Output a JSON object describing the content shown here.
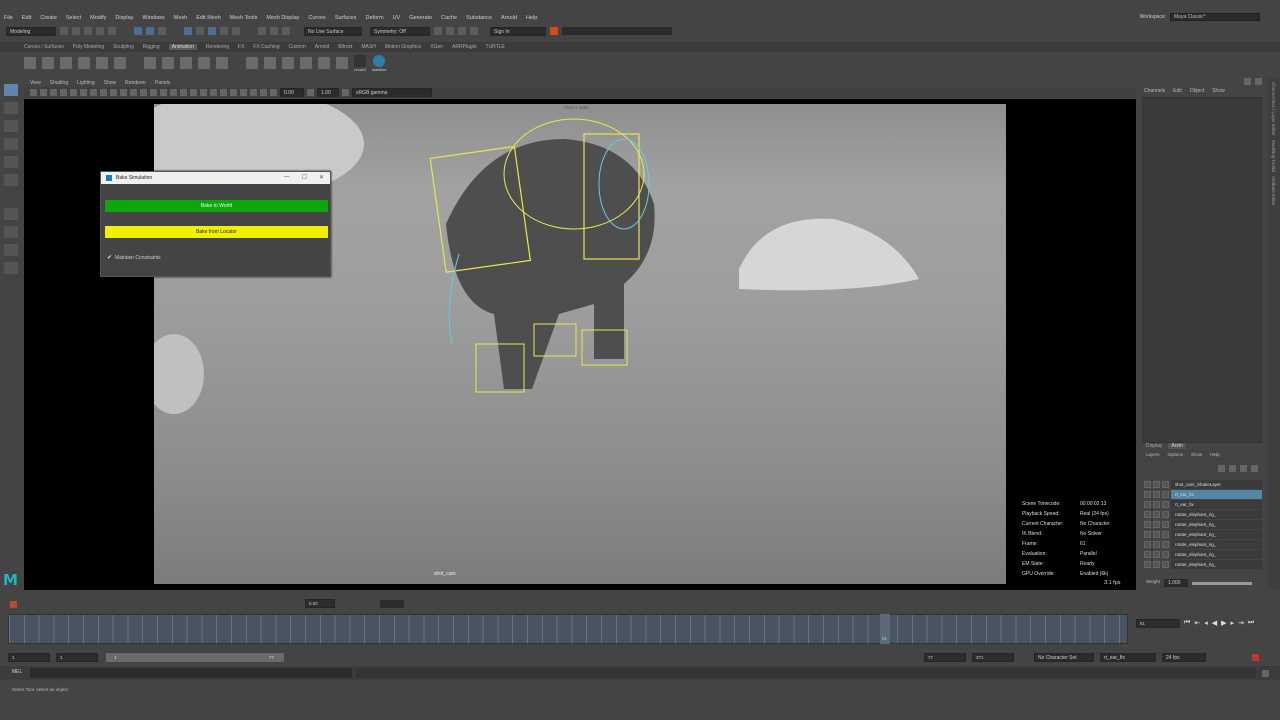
{
  "menubar": {
    "items": [
      "File",
      "Edit",
      "Create",
      "Select",
      "Modify",
      "Display",
      "Windows",
      "Mesh",
      "Edit Mesh",
      "Mesh Tools",
      "Mesh Display",
      "Curves",
      "Surfaces",
      "Deform",
      "UV",
      "Generate",
      "Cache",
      "Substance",
      "Arnold",
      "Help"
    ],
    "workspace_label": "Workspace:",
    "workspace_value": "Maya Classic*"
  },
  "statusline": {
    "mode": "Modeling",
    "live_surface": "No Live Surface",
    "symmetry": "Symmetry: Off",
    "sign_in": "Sign In"
  },
  "shelf_tabs": [
    "Curves / Surfaces",
    "Poly Modeling",
    "Sculpting",
    "Rigging",
    "Animation",
    "Rendering",
    "FX",
    "FX Caching",
    "Custom",
    "Arnold",
    "Bifrost",
    "MASH",
    "Motion Graphics",
    "XGen",
    "ARRPlugin",
    "TURTLE"
  ],
  "shelf_active": "Animation",
  "shelf_buttons": [
    "record",
    "stabilize"
  ],
  "panel_menu": [
    "View",
    "Shading",
    "Lighting",
    "Show",
    "Renderer",
    "Panels"
  ],
  "panel_toolbar": {
    "value_a": "0.00",
    "value_b": "1.00",
    "color_space": "sRGB gamma"
  },
  "viewport": {
    "camera_name": "shot_cam",
    "resolution_gate": "1920 x 1080",
    "hud": [
      {
        "k": "Scene Timecode:",
        "v": "00:00:02:13"
      },
      {
        "k": "Playback Speed:",
        "v": "Real (24 fps)"
      },
      {
        "k": "Current Character:",
        "v": "No Character"
      },
      {
        "k": "IK Blend:",
        "v": "No Solver"
      },
      {
        "k": "Frame:",
        "v": "61"
      },
      {
        "k": "Evaluation:",
        "v": "Parallel"
      },
      {
        "k": "EM State:",
        "v": "Ready"
      },
      {
        "k": "GPU Override:",
        "v": "Enabled (6k)"
      }
    ],
    "fps": "3.1 fps"
  },
  "dialog": {
    "title": "Bake Simulation",
    "bake_to_world": "Bake to World",
    "bake_from_locator": "Bake from Locator",
    "maintain_constraints": "Maintain Constraints",
    "maintain_checked": true,
    "btn_min": "—",
    "btn_max": "☐",
    "btn_close": "✕"
  },
  "channel_box": {
    "menu": [
      "Channels",
      "Edit",
      "Object",
      "Show"
    ]
  },
  "side_tabs": [
    "Channel Box / Layer Editor",
    "Modeling Toolkit",
    "Attribute Editor"
  ],
  "layer_editor": {
    "tabs": [
      "Display",
      "Anim"
    ],
    "active_tab": "Anim",
    "menu": [
      "Layers",
      "Options",
      "Show",
      "Help"
    ],
    "layers": [
      {
        "name": "shot_cam_ShakeLayer",
        "selected": false
      },
      {
        "name": "rt_ear_fix",
        "selected": true
      },
      {
        "name": "rt_ear_fix",
        "selected": false
      },
      {
        "name": "rotate_elephant_rig_",
        "selected": false
      },
      {
        "name": "rotate_elephant_rig_",
        "selected": false
      },
      {
        "name": "rotate_elephant_rig_",
        "selected": false
      },
      {
        "name": "rotate_elephant_rig_",
        "selected": false
      },
      {
        "name": "rotate_elephant_rig_",
        "selected": false
      },
      {
        "name": "rotate_elephant_rig_",
        "selected": false
      }
    ],
    "weight_label": "Weight",
    "weight_value": "1.000"
  },
  "time_slider": {
    "current_frame": "61",
    "frame_field": "0.00"
  },
  "range_slider": {
    "start": "1",
    "anim_start": "1",
    "range_start": "1",
    "range_end": "77",
    "anim_end": "77",
    "end": "371",
    "character_set": "No Character Set",
    "anim_layer": "rt_ear_fix",
    "fps": "24 fps"
  },
  "command_line": {
    "label": "MEL"
  },
  "help_line": "Select Tool: select an object"
}
